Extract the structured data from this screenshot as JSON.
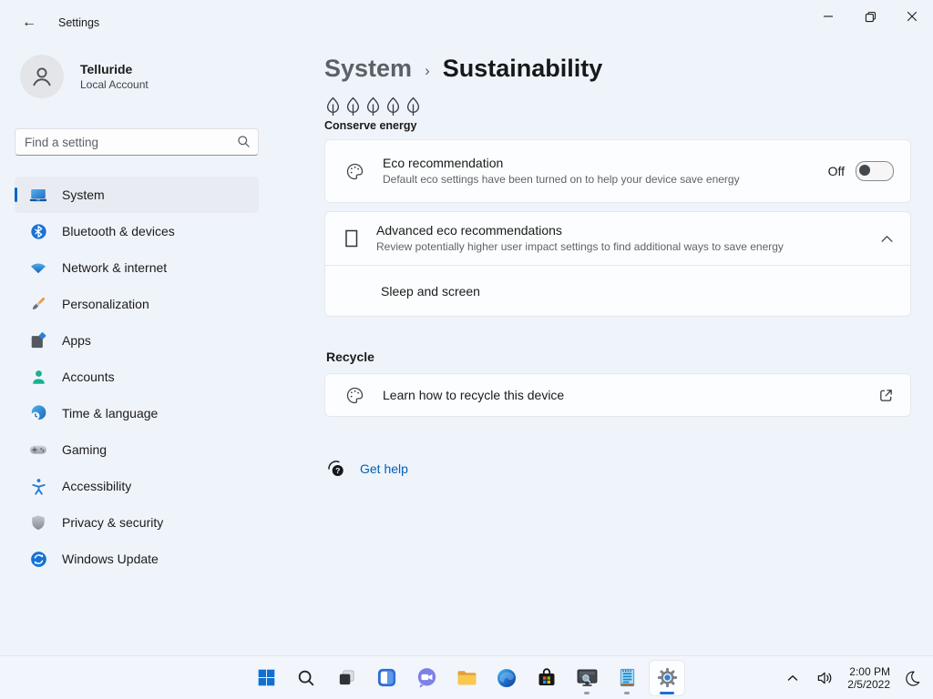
{
  "window": {
    "title": "Settings"
  },
  "account": {
    "name": "Telluride",
    "type": "Local Account"
  },
  "search": {
    "placeholder": "Find a setting"
  },
  "sidebar": {
    "items": [
      {
        "label": "System",
        "icon": "system-icon",
        "active": true
      },
      {
        "label": "Bluetooth & devices",
        "icon": "bluetooth-icon"
      },
      {
        "label": "Network & internet",
        "icon": "network-icon"
      },
      {
        "label": "Personalization",
        "icon": "personalization-icon"
      },
      {
        "label": "Apps",
        "icon": "apps-icon"
      },
      {
        "label": "Accounts",
        "icon": "accounts-icon"
      },
      {
        "label": "Time & language",
        "icon": "time-language-icon"
      },
      {
        "label": "Gaming",
        "icon": "gaming-icon"
      },
      {
        "label": "Accessibility",
        "icon": "accessibility-icon"
      },
      {
        "label": "Privacy & security",
        "icon": "privacy-icon"
      },
      {
        "label": "Windows Update",
        "icon": "windows-update-icon"
      }
    ]
  },
  "main": {
    "breadcrumb": {
      "parent": "System",
      "separator": "›",
      "current": "Sustainability"
    },
    "conserve_energy_label": "Conserve energy",
    "leaf_icon_count": 5,
    "eco_card": {
      "title": "Eco recommendation",
      "description": "Default eco settings have been turned on to help your device save energy",
      "toggle_label": "Off",
      "toggle_state": "off"
    },
    "advanced_card": {
      "title": "Advanced eco recommendations",
      "description": "Review potentially higher user impact settings to find additional ways to save energy",
      "expanded": true,
      "sub_item": "Sleep and screen"
    },
    "recycle_section": {
      "header": "Recycle",
      "link_title": "Learn how to recycle this device"
    },
    "get_help_label": "Get help"
  },
  "taskbar": {
    "icons": [
      "start",
      "search",
      "task-view",
      "widgets",
      "chat",
      "file-explorer",
      "edge",
      "store",
      "monitor-app",
      "notepad",
      "settings-gear"
    ],
    "tray": {
      "icons": [
        "chevron-up",
        "speaker",
        "clock",
        "moon"
      ],
      "time": "2:00 PM",
      "date": "2/5/2022"
    }
  },
  "colors": {
    "accent": "#0067c0",
    "link": "#005fb8",
    "background": "#eff4fb",
    "card": "#fcfdfe"
  }
}
